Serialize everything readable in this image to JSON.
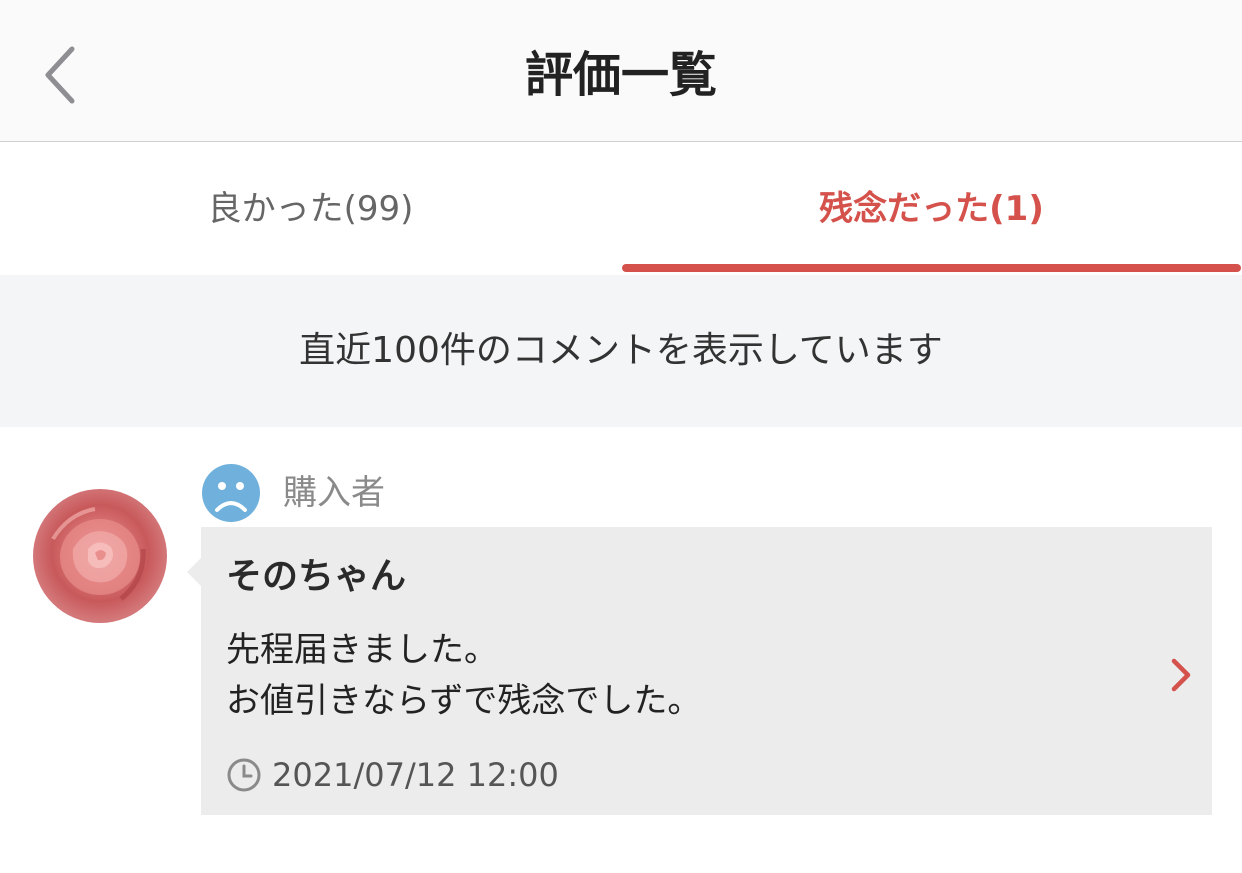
{
  "header": {
    "title": "評価一覧",
    "back_icon": "chevron-left-icon"
  },
  "tabs": [
    {
      "label": "良かった(99)",
      "active": false
    },
    {
      "label": "残念だった(1)",
      "active": true
    }
  ],
  "colors": {
    "accent": "#d4524b",
    "face_icon": "#6fb1dc"
  },
  "notice": "直近100件のコメントを表示しています",
  "review": {
    "role": "購入者",
    "sentiment_icon": "sad-face-icon",
    "name": "そのちゃん",
    "comment_lines": [
      "先程届きました。",
      "お値引きならずで残念でした。"
    ],
    "datetime": "2021/07/12 12:00"
  }
}
